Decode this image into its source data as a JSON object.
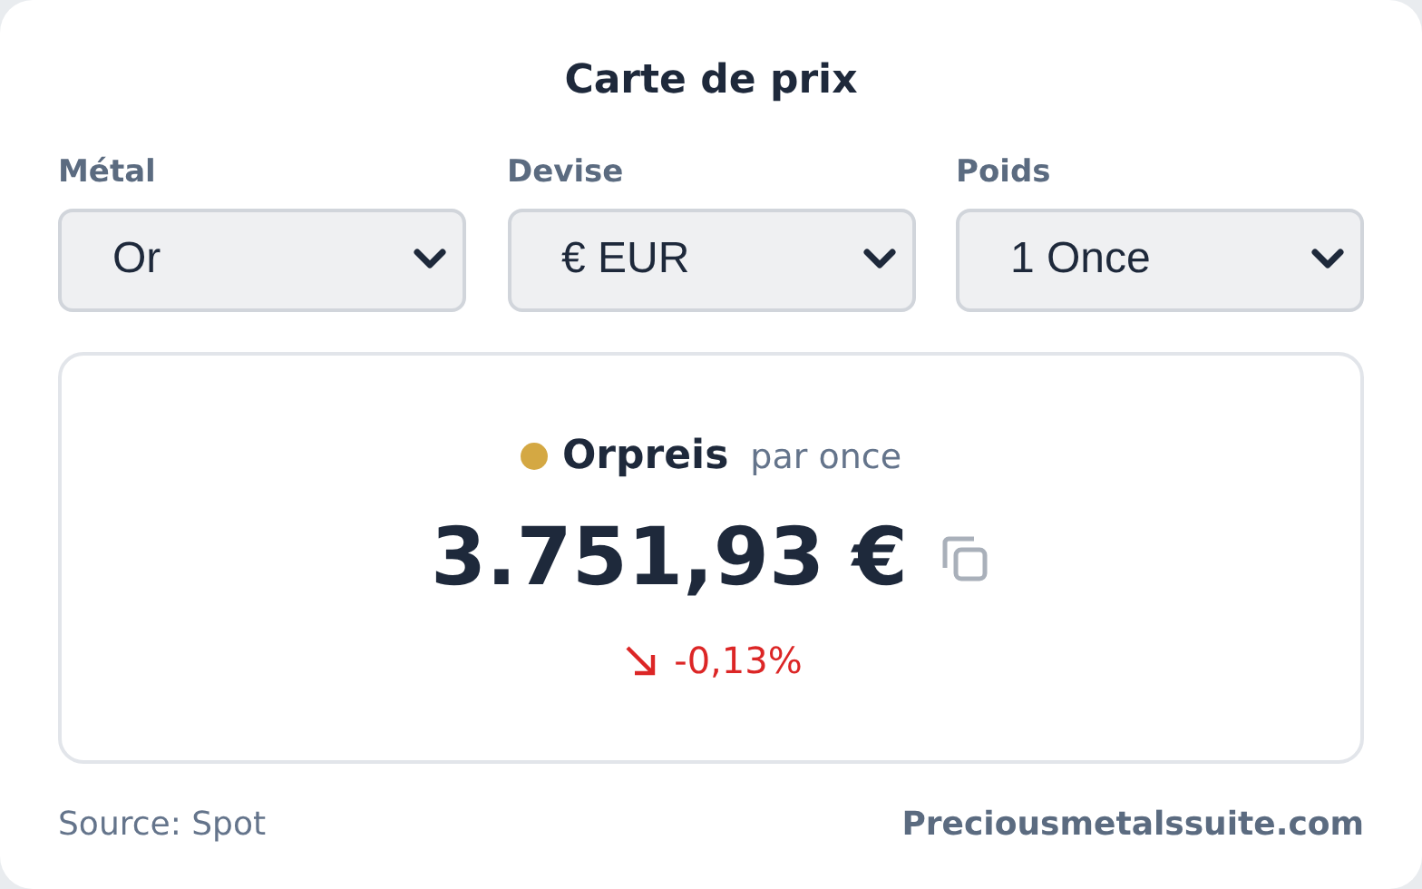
{
  "title": "Carte de prix",
  "selects": [
    {
      "label": "Métal",
      "value": "Or"
    },
    {
      "label": "Devise",
      "value": "€ EUR"
    },
    {
      "label": "Poids",
      "value": "1 Once"
    }
  ],
  "price": {
    "color": "#d4a843",
    "name": "Orpreis",
    "unit": "par once",
    "amount": "3.751,93 €",
    "falling": true,
    "change": "-0,13%"
  },
  "footer": {
    "source": "Source: Spot",
    "link": "Preciousmetalssuite.com"
  }
}
